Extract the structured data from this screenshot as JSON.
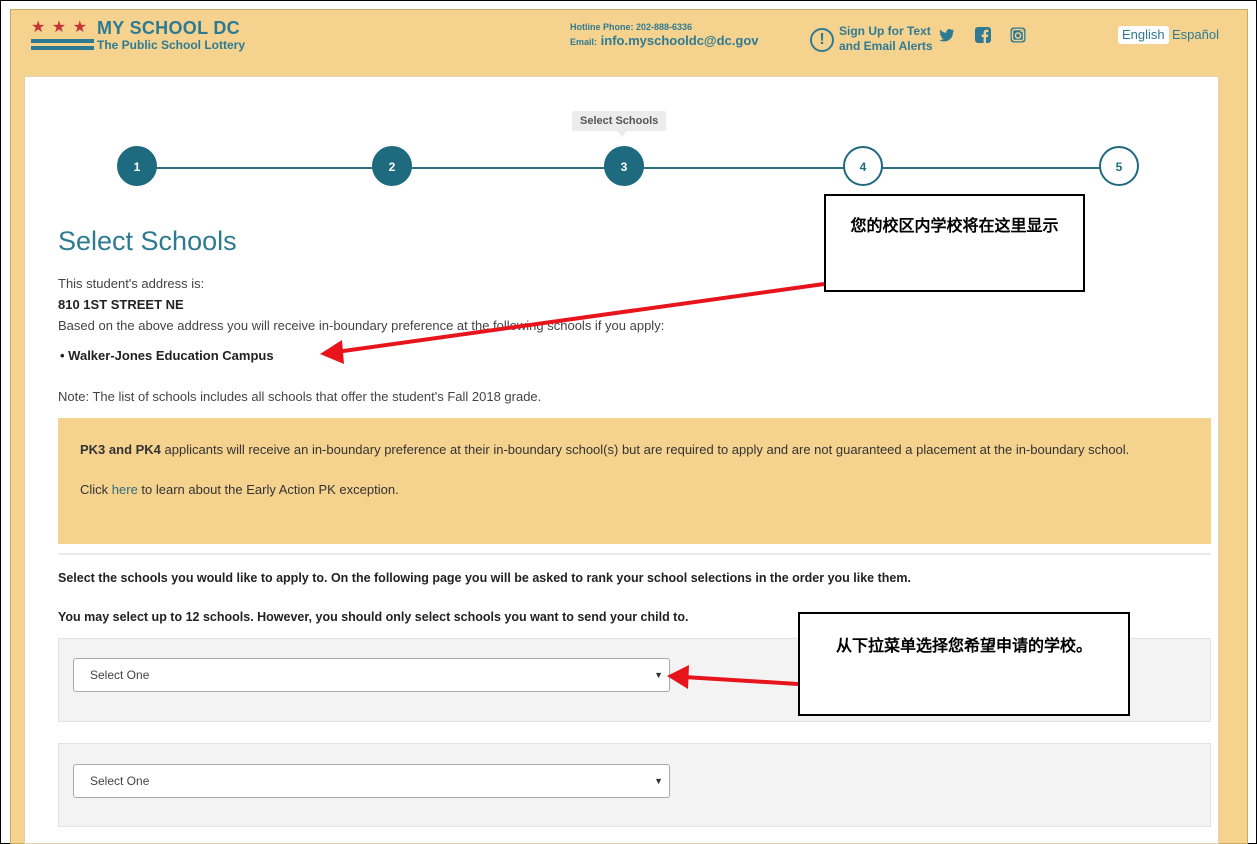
{
  "header": {
    "stars": "★ ★ ★",
    "logo_title": "MY SCHOOL DC",
    "logo_subtitle": "The Public School Lottery",
    "hotline": "Hotline Phone: 202-888-6336",
    "email_label": "Email:",
    "email": "info.myschooldc@dc.gov",
    "alert_icon": "!",
    "alert_text": "Sign Up for Text and Email Alerts",
    "lang_en": "English",
    "lang_es": "Español"
  },
  "stepper": {
    "current_label": "Select Schools",
    "steps": [
      "1",
      "2",
      "3",
      "4",
      "5"
    ]
  },
  "content": {
    "title": "Select Schools",
    "address_label": "This student's address is:",
    "address": "810 1ST STREET NE",
    "boundary_text": "Based on the above address you will receive in-boundary preference at the following schools if you apply:",
    "boundary_school": "Walker-Jones Education Campus",
    "note": "Note: The list of schools includes all schools that offer the student's Fall 2018 grade.",
    "notice_bold": "PK3 and PK4",
    "notice_text": " applicants will receive an in-boundary preference at their in-boundary school(s) but are required to apply and are not guaranteed a placement at the in-boundary school.",
    "notice_click": "Click ",
    "notice_link": "here",
    "notice_after": " to learn about the Early Action PK exception.",
    "instructions": "Select the schools you would like to apply to. On the following page you will be asked to rank your school selections in the order you like them.",
    "limit": "You may select up to 12 schools. However, you should only select schools you want to send your child to.",
    "select_1": "Select One",
    "select_2": "Select One"
  },
  "callouts": {
    "boundary": "您的校区内学校将在这里显示",
    "dropdown": "从下拉菜单选择您希望申请的学校。"
  },
  "colors": {
    "brand": "#2f7a93",
    "banner": "#f5d38f",
    "star": "#c8333b",
    "arrow": "#e8141c"
  }
}
